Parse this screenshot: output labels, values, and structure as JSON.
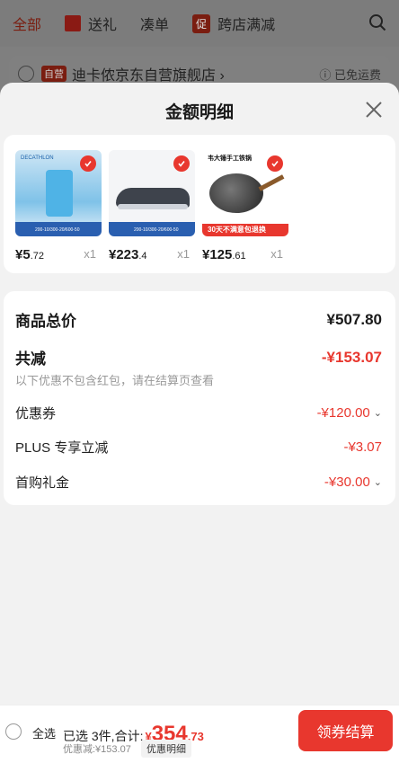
{
  "bg": {
    "tabs": [
      "全部",
      "送礼",
      "凑单",
      "跨店满减"
    ],
    "promo_badge": "促",
    "store_badge": "自营",
    "store_name": "迪卡侬京东自营旗舰店 ›",
    "free_shipping": "ⓘ 已免运费"
  },
  "sheet": {
    "title": "金额明细"
  },
  "products": [
    {
      "price_int": "¥5",
      "price_dec": ".72",
      "qty": "x1",
      "img_label": "DECATHLON",
      "img_caption": "200-10/300-20/600-50"
    },
    {
      "price_int": "¥223",
      "price_dec": ".4",
      "qty": "x1",
      "img_label": "",
      "img_caption": "200-10/300-20/600-50"
    },
    {
      "price_int": "¥125",
      "price_dec": ".61",
      "qty": "x1",
      "img_label": "韦大锤手工铁锅",
      "img_caption": "30天不满意包退换"
    }
  ],
  "summary": {
    "goods_total_label": "商品总价",
    "goods_total_value": "¥507.80",
    "reduce_label": "共减",
    "reduce_value": "-¥153.07",
    "note": "以下优惠不包含红包，请在结算页查看",
    "coupon_label": "优惠券",
    "coupon_value": "-¥120.00",
    "plus_label": "PLUS 专享立减",
    "plus_value": "-¥3.07",
    "first_label": "首购礼金",
    "first_value": "-¥30.00"
  },
  "bottom": {
    "select_all": "全选",
    "selected_text": "已选 3件,合计:",
    "total_yen": "¥",
    "total_int": "354",
    "total_dec": ".73",
    "discount": "优惠减:¥153.07",
    "detail": "优惠明细",
    "checkout": "领券结算"
  },
  "colors": {
    "accent": "#e8372e",
    "background": "#f2f2f2"
  }
}
